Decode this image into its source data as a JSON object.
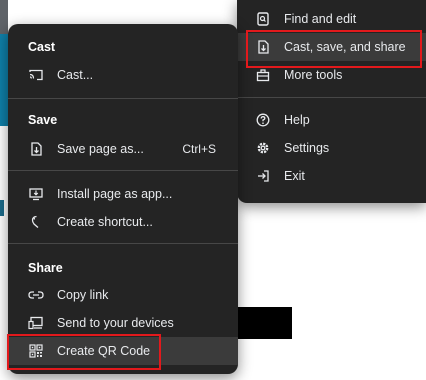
{
  "main_menu": {
    "items": [
      {
        "label": "Find and edit",
        "icon": "find-edit-icon"
      },
      {
        "label": "Cast, save, and share",
        "icon": "cast-save-share-icon"
      },
      {
        "label": "More tools",
        "icon": "toolbox-icon"
      },
      {
        "label": "Help",
        "icon": "help-icon"
      },
      {
        "label": "Settings",
        "icon": "gear-icon"
      },
      {
        "label": "Exit",
        "icon": "exit-icon"
      }
    ]
  },
  "sub_menu": {
    "cast_section": {
      "title": "Cast",
      "items": [
        {
          "label": "Cast...",
          "icon": "cast-icon"
        }
      ]
    },
    "save_section": {
      "title": "Save",
      "items": [
        {
          "label": "Save page as...",
          "shortcut": "Ctrl+S",
          "icon": "save-page-icon"
        }
      ]
    },
    "app_section": {
      "items": [
        {
          "label": "Install page as app...",
          "icon": "install-app-icon"
        },
        {
          "label": "Create shortcut...",
          "icon": "shortcut-icon"
        }
      ]
    },
    "share_section": {
      "title": "Share",
      "items": [
        {
          "label": "Copy link",
          "icon": "link-icon"
        },
        {
          "label": "Send to your devices",
          "icon": "devices-icon"
        },
        {
          "label": "Create QR Code",
          "icon": "qr-code-icon"
        }
      ]
    }
  },
  "colors": {
    "menu_bg": "#242424",
    "highlight": "#e2191c",
    "hover": "#3b3b3b"
  }
}
